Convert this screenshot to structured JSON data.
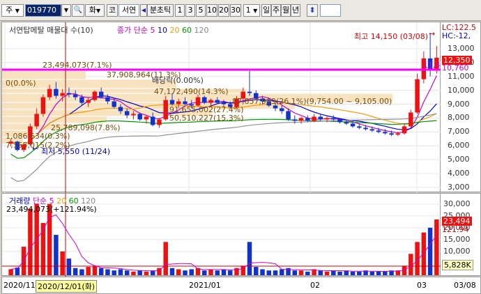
{
  "toolbar": {
    "market_label": "주",
    "stock_code": "019770",
    "search_glyph": "🔍",
    "preset_label": "화",
    "corner_label": "코",
    "stock_name": "서연",
    "prev_glyph": "◀",
    "unit_label": "분초틱",
    "periods": [
      "1",
      "3",
      "5",
      "10",
      "20",
      "30"
    ],
    "interval_value": "1",
    "day_label": "일",
    "week_label": "주",
    "month_label": "월",
    "year_label": "년",
    "updown_glyph": "⬍"
  },
  "price_pane": {
    "title": "서연탑메탈 매물대 수(10)",
    "ma_legend_prefix": "종가 단순 5",
    "ma_periods": [
      "10",
      "20",
      "60",
      "120"
    ],
    "ma_colors": [
      "#cc00cc",
      "#0000dd",
      "#ff9900",
      "#009900",
      "#909090"
    ],
    "high_label": "최고 14,150 (03/08)",
    "low_label": "최저 5,550 (11/24)",
    "dividend_label": "배당락(0.00%)",
    "last_price_label": "11,45",
    "volume_profile_labels": [
      "23,494,073(7.1%)",
      "37,908,964(11.3%)",
      "0(0.0%)",
      "47,172,490(14.3%)",
      "87,857,909(26.1%)(9,754.00 ~ 9,105.00)",
      "91,655,002(27.4%)",
      "50,510,227(15.3%)",
      "1,086,634(0.3%)",
      "25,789,098(7.8%)",
      "7,155,015(2.2%)"
    ],
    "price_ticks": [
      "13,000",
      "12,000",
      "11,000",
      "10,000",
      "9,000",
      "8,000",
      "7,000",
      "6,000",
      "5,000",
      "4,000",
      "3,000"
    ],
    "axis_lc": "LC:122.5",
    "axis_hc": "HC:-12,",
    "current_price_badge": "12,350",
    "line_price_badge": "10,760"
  },
  "volume_pane": {
    "title": "거래량",
    "ma_legend_prefix": "단순 5",
    "ma_periods": [
      "20",
      "60",
      "120"
    ],
    "current_label": "23,494,073(+121.94%)",
    "ticks": [
      "30,000",
      "25,000",
      "20,000",
      "15,000",
      "10,000"
    ],
    "volume_badge": "23,494",
    "pct_badge": "121.94",
    "ma_badge": "5,828K"
  },
  "x_axis": {
    "labels": [
      "2020/11",
      "2020/12/01(화)",
      "2021/01",
      "02",
      "03",
      "03/08"
    ]
  },
  "colors": {
    "up": "#ee1111",
    "down": "#1133cc",
    "highlight_line": "#ff00ff",
    "volume_profile": "#f5dcb0"
  },
  "chart_data": {
    "type": "candlestick",
    "ylim": [
      3000,
      14500
    ],
    "candles": [
      [
        6150,
        6500,
        5950,
        6300
      ],
      [
        6300,
        6350,
        5600,
        5700
      ],
      [
        5700,
        6200,
        5550,
        6100
      ],
      [
        6100,
        7600,
        6000,
        7400
      ],
      [
        7400,
        8700,
        7200,
        8300
      ],
      [
        8300,
        9700,
        8100,
        9500
      ],
      [
        9500,
        10400,
        9300,
        10100
      ],
      [
        10100,
        10600,
        9400,
        9600
      ],
      [
        9600,
        10100,
        9200,
        9800
      ],
      [
        9800,
        10200,
        9500,
        9700
      ],
      [
        9700,
        10000,
        9300,
        9500
      ],
      [
        9500,
        9700,
        8900,
        9100
      ],
      [
        9100,
        9500,
        8800,
        9300
      ],
      [
        9300,
        10000,
        9200,
        9900
      ],
      [
        9900,
        10200,
        9400,
        9500
      ],
      [
        9500,
        9700,
        9000,
        9200
      ],
      [
        9200,
        9400,
        8700,
        8800
      ],
      [
        8800,
        9000,
        8300,
        8500
      ],
      [
        8500,
        8700,
        8000,
        8200
      ],
      [
        8200,
        8500,
        7900,
        8300
      ],
      [
        8300,
        8400,
        7800,
        7900
      ],
      [
        7900,
        8200,
        7600,
        8100
      ],
      [
        8100,
        8400,
        7400,
        7500
      ],
      [
        7500,
        8000,
        7300,
        7900
      ],
      [
        7900,
        9600,
        7800,
        9300
      ],
      [
        9300,
        9800,
        8900,
        9000
      ],
      [
        9000,
        9400,
        8700,
        9200
      ],
      [
        9200,
        9500,
        8900,
        9000
      ],
      [
        9000,
        9300,
        8700,
        8900
      ],
      [
        8900,
        9700,
        8800,
        9500
      ],
      [
        9500,
        9600,
        9000,
        9100
      ],
      [
        9100,
        9400,
        8800,
        9300
      ],
      [
        9300,
        9500,
        9000,
        9100
      ],
      [
        9100,
        9300,
        8800,
        9000
      ],
      [
        9000,
        9200,
        8700,
        8800
      ],
      [
        8800,
        9600,
        8700,
        9400
      ],
      [
        9400,
        10200,
        9100,
        9900
      ],
      [
        9900,
        11400,
        9600,
        9800
      ],
      [
        9800,
        10000,
        9300,
        9400
      ],
      [
        9400,
        9600,
        9000,
        9200
      ],
      [
        9200,
        9400,
        8800,
        8900
      ],
      [
        8900,
        9100,
        8500,
        8700
      ],
      [
        8700,
        8900,
        8300,
        8500
      ],
      [
        8500,
        8700,
        7800,
        7900
      ],
      [
        7900,
        8200,
        7600,
        7800
      ],
      [
        7800,
        8100,
        7600,
        8000
      ],
      [
        8000,
        8200,
        7700,
        7800
      ],
      [
        7800,
        8300,
        7700,
        8100
      ],
      [
        8100,
        8300,
        7800,
        7900
      ],
      [
        7900,
        8100,
        7700,
        8000
      ],
      [
        8000,
        8200,
        7800,
        7900
      ],
      [
        7900,
        8000,
        7600,
        7700
      ],
      [
        7700,
        7900,
        7500,
        7600
      ],
      [
        7600,
        7800,
        7300,
        7400
      ],
      [
        7400,
        7600,
        7200,
        7300
      ],
      [
        7300,
        7500,
        7100,
        7200
      ],
      [
        7200,
        7400,
        7000,
        7100
      ],
      [
        7100,
        7300,
        6900,
        7000
      ],
      [
        7000,
        7200,
        6800,
        6900
      ],
      [
        6900,
        7100,
        6700,
        6800
      ],
      [
        6800,
        7000,
        6700,
        6900
      ],
      [
        6900,
        7600,
        6800,
        7400
      ],
      [
        7400,
        8600,
        7300,
        8400
      ],
      [
        8400,
        11200,
        8300,
        10800
      ],
      [
        10800,
        12800,
        10500,
        12300
      ],
      [
        12300,
        14150,
        11000,
        11450
      ],
      [
        11450,
        13200,
        11200,
        12350
      ]
    ],
    "volumes": [
      2500,
      3200,
      12000,
      28000,
      30000,
      22000,
      30000,
      17000,
      10000,
      7000,
      3000,
      2500,
      3500,
      4000,
      3000,
      2500,
      2000,
      2500,
      2000,
      1500,
      2000,
      1500,
      2000,
      3000,
      14000,
      3000,
      2500,
      2000,
      2500,
      3000,
      2000,
      2500,
      2000,
      2500,
      2000,
      3000,
      4000,
      14000,
      3500,
      2500,
      2000,
      2000,
      2500,
      3000,
      2000,
      2000,
      1500,
      2500,
      2000,
      1500,
      2000,
      1500,
      2000,
      1500,
      1500,
      2000,
      1500,
      1500,
      1500,
      2000,
      2000,
      4000,
      9000,
      14000,
      18000,
      20000,
      23494
    ],
    "volume_ylim": [
      0,
      32000
    ],
    "highlight_price": 10760
  }
}
